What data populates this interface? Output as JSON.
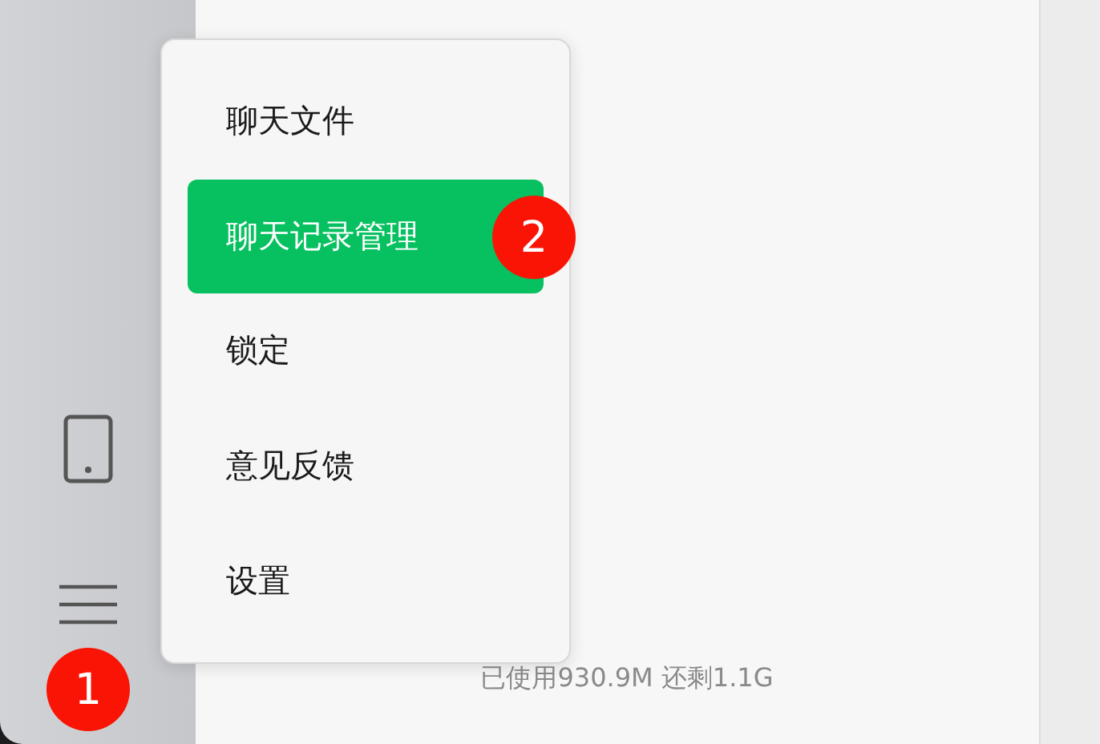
{
  "menu": {
    "items": [
      {
        "label": "聊天文件",
        "selected": false
      },
      {
        "label": "聊天记录管理",
        "selected": true
      },
      {
        "label": "锁定",
        "selected": false
      },
      {
        "label": "意见反馈",
        "selected": false
      },
      {
        "label": "设置",
        "selected": false
      }
    ]
  },
  "storage": {
    "text": "已使用930.9M 还剩1.1G"
  },
  "step_badges": [
    {
      "label": "1"
    },
    {
      "label": "2"
    }
  ]
}
